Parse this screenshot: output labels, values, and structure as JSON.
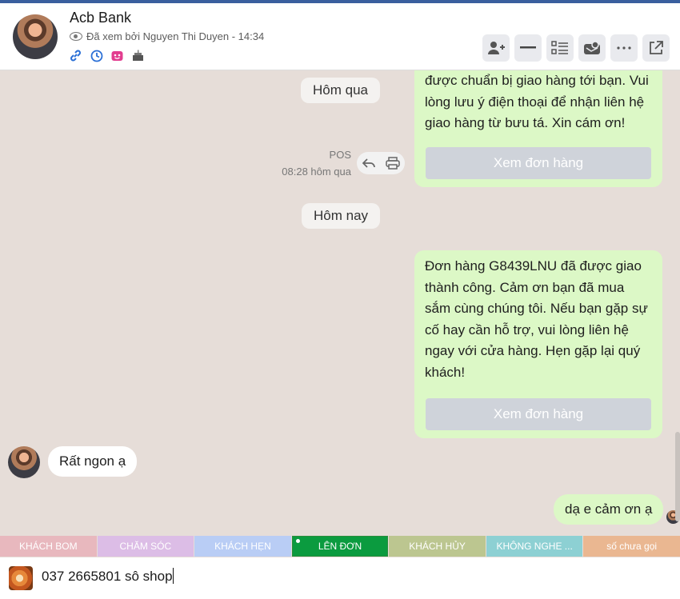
{
  "header": {
    "title": "Acb Bank",
    "seen_text": "Đã xem bởi Nguyen Thi Duyen - 14:34",
    "icons": [
      "link-icon",
      "history-icon",
      "gift-box-icon",
      "cake-icon"
    ],
    "toolbar": [
      "add-member-icon",
      "minimize-icon",
      "list-icon",
      "card-icon",
      "more-icon",
      "open-external-icon"
    ]
  },
  "chat": {
    "date_yesterday": "Hôm qua",
    "msg1_lines": [
      "được chuẩn bị giao hàng tới bạn. Vui",
      "lòng lưu ý điện thoại để nhận liên hệ",
      "giao hàng từ bưu tá. Xin cám ơn!"
    ],
    "msg1_button": "Xem đơn hàng",
    "msg1_sender": "POS",
    "msg1_time": "08:28 hôm qua",
    "date_today": "Hôm nay",
    "msg2_lines": [
      "Đơn hàng G8439LNU đã được giao",
      "thành công. Cảm ơn bạn đã mua",
      "sắm cùng chúng tôi. Nếu bạn gặp sự",
      "cố hay cần hỗ trợ, vui lòng liên hệ",
      "ngay với cửa hàng. Hẹn gặp lại quý",
      "khách!"
    ],
    "msg2_button": "Xem đơn hàng",
    "incoming_text": "Rất ngon ạ",
    "reply_text": "dạ e cảm ơn ạ"
  },
  "tags": [
    {
      "label": "KHÁCH BOM",
      "color": "#e8b8be"
    },
    {
      "label": "CHĂM SÓC",
      "color": "#dcbde6"
    },
    {
      "label": "KHÁCH HẸN",
      "color": "#b9cdf5"
    },
    {
      "label": "LÊN ĐƠN",
      "color": "#0b9b3f"
    },
    {
      "label": "KHÁCH HỦY",
      "color": "#bcc690"
    },
    {
      "label": "KHÔNG NGHE ...",
      "color": "#8dd0d3"
    },
    {
      "label": "số chưa gọi",
      "color": "#eab791"
    }
  ],
  "composer": {
    "value": "037 2665801 sô shop"
  }
}
